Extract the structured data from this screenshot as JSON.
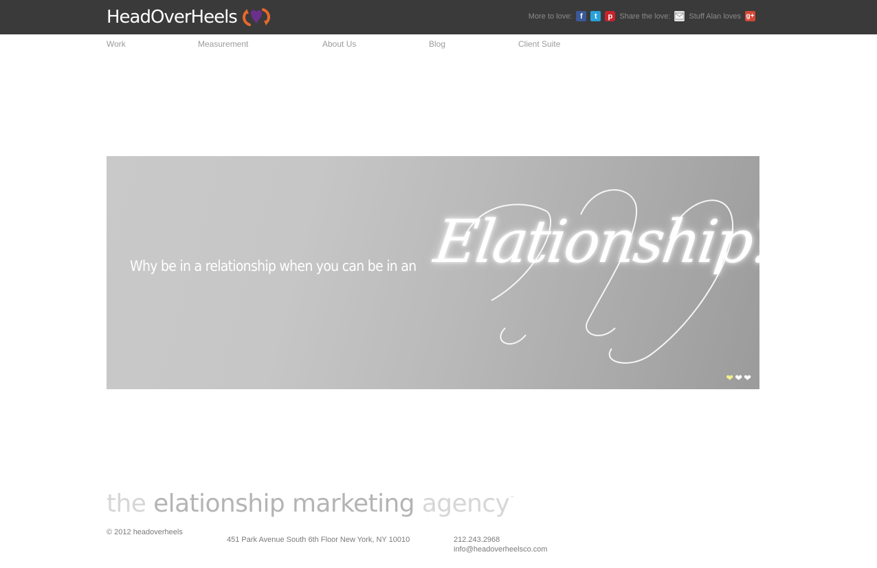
{
  "header": {
    "logo_text": "HeadOverHeels",
    "more_label": "More to love:",
    "share_label": "Share the love:",
    "stuff_label": "Stuff Alan loves",
    "icons": [
      "facebook-icon",
      "twitter-icon",
      "pinterest-icon",
      "mail-icon",
      "google-plus-icon"
    ],
    "colors": {
      "bar": "#3a3a3a",
      "logo_accent_orange": "#e8692a",
      "logo_accent_purple": "#6b2f8c"
    }
  },
  "nav": {
    "items": [
      {
        "label": "Work"
      },
      {
        "label": "Measurement"
      },
      {
        "label": "About Us"
      },
      {
        "label": "Blog"
      },
      {
        "label": "Client Suite"
      }
    ]
  },
  "hero": {
    "subtitle": "Why be in a relationship when you can be in an",
    "script_word": "Elationship?",
    "slides": 3,
    "active_slide": 1
  },
  "tagline": {
    "part1": "the ",
    "part2": "elationship marketing",
    "part3": " agency",
    "tm": "™"
  },
  "footer": {
    "copyright": "© 2012 headoverheels",
    "address": "451 Park Avenue South 6th Floor New York, NY 10010",
    "phone": "212.243.2968",
    "email": "info@headoverheelsco.com"
  }
}
